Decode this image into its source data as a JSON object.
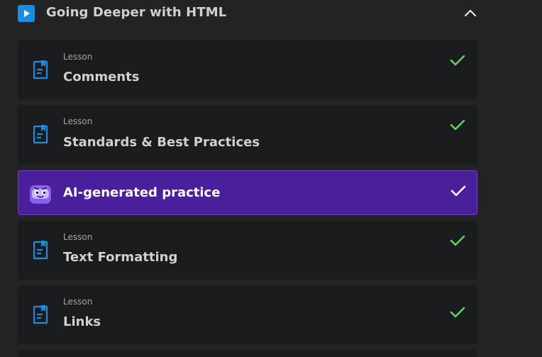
{
  "section": {
    "title": "Going Deeper with HTML",
    "icon": "play-icon",
    "accent": "#1a8de0",
    "collapse_icon": "chevron-up-icon"
  },
  "items": [
    {
      "kind": "Lesson",
      "title": "Comments",
      "icon": "document-icon",
      "status_icon": "check-icon",
      "completed": true
    },
    {
      "kind": "Lesson",
      "title": "Standards & Best Practices",
      "icon": "document-icon",
      "status_icon": "check-icon",
      "completed": true
    },
    {
      "kind": "",
      "title": "AI-generated practice",
      "icon": "robot-icon",
      "status_icon": "check-icon",
      "completed": true,
      "highlight": "#4a1f9b"
    },
    {
      "kind": "Lesson",
      "title": "Text Formatting",
      "icon": "document-icon",
      "status_icon": "check-icon",
      "completed": true
    },
    {
      "kind": "Lesson",
      "title": "Links",
      "icon": "document-icon",
      "status_icon": "check-icon",
      "completed": true
    }
  ],
  "colors": {
    "background": "#232326",
    "card": "#1a1b1e",
    "check": "#5fd35f",
    "doc_icon": "#1a8de0"
  }
}
